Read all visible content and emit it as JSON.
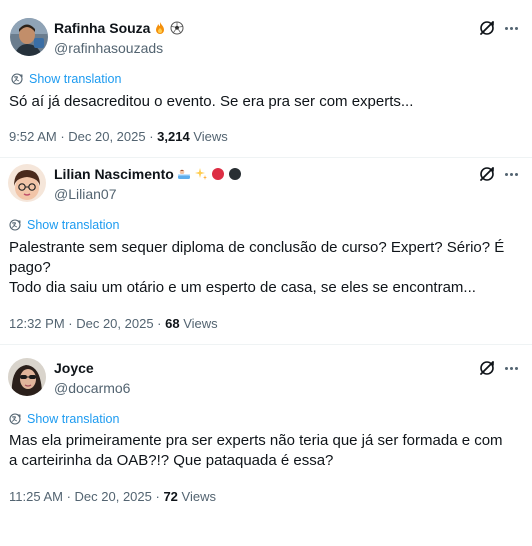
{
  "tweets": [
    {
      "display_name": "Rafinha Souza",
      "handle": "@rafinhasouzads",
      "name_emojis": [
        "fire-emoji",
        "soccer-ball-emoji"
      ],
      "translate_label": "Show translation",
      "text": "Só aí já desacreditou o evento. Se era pra ser com experts...",
      "time": "9:52 AM",
      "date": "Dec 20, 2025",
      "views_count": "3,214",
      "views_label": "Views"
    },
    {
      "display_name": "Lilian Nascimento",
      "handle": "@Lilian07",
      "name_emojis": [
        "person-in-bathtub-emoji",
        "sparkles-emoji",
        "red-circle-emoji",
        "black-circle-emoji"
      ],
      "translate_label": "Show translation",
      "text": "Palestrante sem sequer diploma de conclusão de curso? Expert? Sério? É pago?\nTodo dia saiu um otário e um esperto de casa, se eles se encontram...",
      "time": "12:32 PM",
      "date": "Dec 20, 2025",
      "views_count": "68",
      "views_label": "Views"
    },
    {
      "display_name": "Joyce",
      "handle": "@docarmo6",
      "name_emojis": [],
      "translate_label": "Show translation",
      "text": "Mas ela primeiramente pra ser experts não teria que já ser formada e com a carteirinha da OAB?!? Que pataquada é essa?",
      "time": "11:25 AM",
      "date": "Dec 20, 2025",
      "views_count": "72",
      "views_label": "Views"
    }
  ],
  "colors": {
    "link": "#1d9bf0",
    "secondary_text": "#536471",
    "primary_text": "#0f1419",
    "divider": "#eff3f4"
  },
  "icons": {
    "grok": "grok-icon",
    "more": "more-options-icon",
    "translate": "globe-translate-icon"
  }
}
